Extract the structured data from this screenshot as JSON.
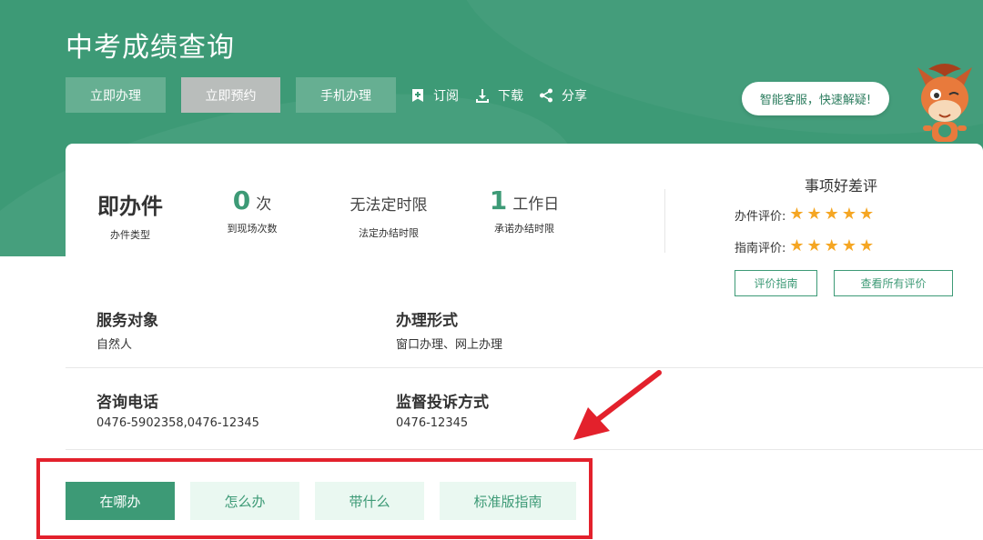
{
  "header": {
    "title": "中考成绩查询",
    "buttons": {
      "handle": "立即办理",
      "reserve": "立即预约",
      "mobile": "手机办理"
    },
    "links": {
      "subscribe": "订阅",
      "download": "下载",
      "share": "分享"
    },
    "service_prompt": "智能客服，快速解疑!"
  },
  "stats": {
    "type": {
      "value": "即办件",
      "caption": "办件类型"
    },
    "visits": {
      "value": "0",
      "unit": "次",
      "caption": "到现场次数"
    },
    "legal": {
      "value": "无法定时限",
      "caption": "法定办结时限"
    },
    "promise": {
      "value": "1",
      "unit": "工作日",
      "caption": "承诺办结时限"
    }
  },
  "evaluation": {
    "title": "事项好差评",
    "rows": [
      {
        "label": "办件评价:",
        "stars": 5
      },
      {
        "label": "指南评价:",
        "stars": 5
      }
    ],
    "buttons": {
      "guide": "评价指南",
      "all": "查看所有评价"
    }
  },
  "info": {
    "target": {
      "label": "服务对象",
      "value": "自然人"
    },
    "form": {
      "label": "办理形式",
      "value": "窗口办理、网上办理"
    },
    "phone": {
      "label": "咨询电话",
      "value": "0476-5902358,0476-12345"
    },
    "complaint": {
      "label": "监督投诉方式",
      "value": "0476-12345"
    }
  },
  "tabs": [
    {
      "label": "在哪办",
      "active": true
    },
    {
      "label": "怎么办",
      "active": false
    },
    {
      "label": "带什么",
      "active": false
    },
    {
      "label": "标准版指南",
      "active": false
    }
  ],
  "colors": {
    "brand_green": "#3d9a76",
    "light_green": "#eaf8f1",
    "star": "#f5a623",
    "annotation_red": "#e3212c"
  }
}
